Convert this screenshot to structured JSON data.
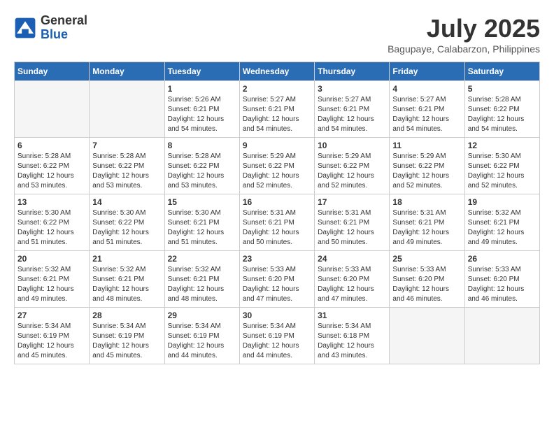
{
  "header": {
    "logo_general": "General",
    "logo_blue": "Blue",
    "month_year": "July 2025",
    "location": "Bagupaye, Calabarzon, Philippines"
  },
  "weekdays": [
    "Sunday",
    "Monday",
    "Tuesday",
    "Wednesday",
    "Thursday",
    "Friday",
    "Saturday"
  ],
  "weeks": [
    [
      {
        "day": "",
        "info": ""
      },
      {
        "day": "",
        "info": ""
      },
      {
        "day": "1",
        "info": "Sunrise: 5:26 AM\nSunset: 6:21 PM\nDaylight: 12 hours and 54 minutes."
      },
      {
        "day": "2",
        "info": "Sunrise: 5:27 AM\nSunset: 6:21 PM\nDaylight: 12 hours and 54 minutes."
      },
      {
        "day": "3",
        "info": "Sunrise: 5:27 AM\nSunset: 6:21 PM\nDaylight: 12 hours and 54 minutes."
      },
      {
        "day": "4",
        "info": "Sunrise: 5:27 AM\nSunset: 6:21 PM\nDaylight: 12 hours and 54 minutes."
      },
      {
        "day": "5",
        "info": "Sunrise: 5:28 AM\nSunset: 6:22 PM\nDaylight: 12 hours and 54 minutes."
      }
    ],
    [
      {
        "day": "6",
        "info": "Sunrise: 5:28 AM\nSunset: 6:22 PM\nDaylight: 12 hours and 53 minutes."
      },
      {
        "day": "7",
        "info": "Sunrise: 5:28 AM\nSunset: 6:22 PM\nDaylight: 12 hours and 53 minutes."
      },
      {
        "day": "8",
        "info": "Sunrise: 5:28 AM\nSunset: 6:22 PM\nDaylight: 12 hours and 53 minutes."
      },
      {
        "day": "9",
        "info": "Sunrise: 5:29 AM\nSunset: 6:22 PM\nDaylight: 12 hours and 52 minutes."
      },
      {
        "day": "10",
        "info": "Sunrise: 5:29 AM\nSunset: 6:22 PM\nDaylight: 12 hours and 52 minutes."
      },
      {
        "day": "11",
        "info": "Sunrise: 5:29 AM\nSunset: 6:22 PM\nDaylight: 12 hours and 52 minutes."
      },
      {
        "day": "12",
        "info": "Sunrise: 5:30 AM\nSunset: 6:22 PM\nDaylight: 12 hours and 52 minutes."
      }
    ],
    [
      {
        "day": "13",
        "info": "Sunrise: 5:30 AM\nSunset: 6:22 PM\nDaylight: 12 hours and 51 minutes."
      },
      {
        "day": "14",
        "info": "Sunrise: 5:30 AM\nSunset: 6:22 PM\nDaylight: 12 hours and 51 minutes."
      },
      {
        "day": "15",
        "info": "Sunrise: 5:30 AM\nSunset: 6:21 PM\nDaylight: 12 hours and 51 minutes."
      },
      {
        "day": "16",
        "info": "Sunrise: 5:31 AM\nSunset: 6:21 PM\nDaylight: 12 hours and 50 minutes."
      },
      {
        "day": "17",
        "info": "Sunrise: 5:31 AM\nSunset: 6:21 PM\nDaylight: 12 hours and 50 minutes."
      },
      {
        "day": "18",
        "info": "Sunrise: 5:31 AM\nSunset: 6:21 PM\nDaylight: 12 hours and 49 minutes."
      },
      {
        "day": "19",
        "info": "Sunrise: 5:32 AM\nSunset: 6:21 PM\nDaylight: 12 hours and 49 minutes."
      }
    ],
    [
      {
        "day": "20",
        "info": "Sunrise: 5:32 AM\nSunset: 6:21 PM\nDaylight: 12 hours and 49 minutes."
      },
      {
        "day": "21",
        "info": "Sunrise: 5:32 AM\nSunset: 6:21 PM\nDaylight: 12 hours and 48 minutes."
      },
      {
        "day": "22",
        "info": "Sunrise: 5:32 AM\nSunset: 6:21 PM\nDaylight: 12 hours and 48 minutes."
      },
      {
        "day": "23",
        "info": "Sunrise: 5:33 AM\nSunset: 6:20 PM\nDaylight: 12 hours and 47 minutes."
      },
      {
        "day": "24",
        "info": "Sunrise: 5:33 AM\nSunset: 6:20 PM\nDaylight: 12 hours and 47 minutes."
      },
      {
        "day": "25",
        "info": "Sunrise: 5:33 AM\nSunset: 6:20 PM\nDaylight: 12 hours and 46 minutes."
      },
      {
        "day": "26",
        "info": "Sunrise: 5:33 AM\nSunset: 6:20 PM\nDaylight: 12 hours and 46 minutes."
      }
    ],
    [
      {
        "day": "27",
        "info": "Sunrise: 5:34 AM\nSunset: 6:19 PM\nDaylight: 12 hours and 45 minutes."
      },
      {
        "day": "28",
        "info": "Sunrise: 5:34 AM\nSunset: 6:19 PM\nDaylight: 12 hours and 45 minutes."
      },
      {
        "day": "29",
        "info": "Sunrise: 5:34 AM\nSunset: 6:19 PM\nDaylight: 12 hours and 44 minutes."
      },
      {
        "day": "30",
        "info": "Sunrise: 5:34 AM\nSunset: 6:19 PM\nDaylight: 12 hours and 44 minutes."
      },
      {
        "day": "31",
        "info": "Sunrise: 5:34 AM\nSunset: 6:18 PM\nDaylight: 12 hours and 43 minutes."
      },
      {
        "day": "",
        "info": ""
      },
      {
        "day": "",
        "info": ""
      }
    ]
  ]
}
